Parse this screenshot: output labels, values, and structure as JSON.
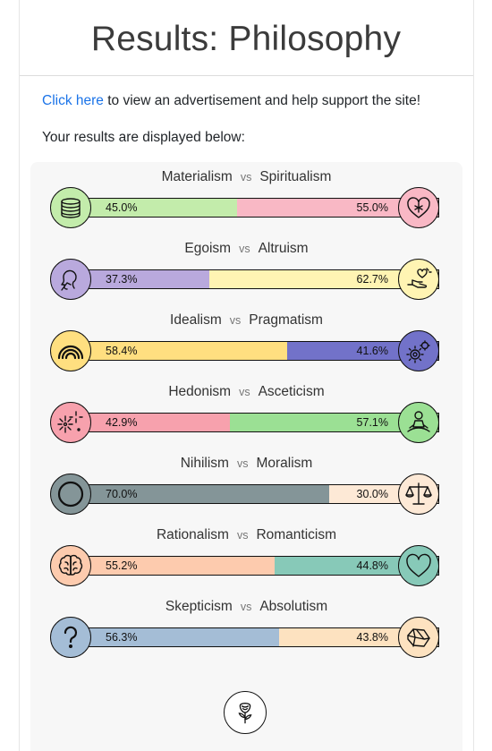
{
  "page": {
    "title": "Results: Philosophy",
    "ad_link": "Click here",
    "ad_rest": " to view an advertisement and help support the site!",
    "intro": "Your results are displayed below:",
    "vs": "vs"
  },
  "results": [
    {
      "left": "Materialism",
      "right": "Spiritualism",
      "left_pct": 45.0,
      "right_pct": 55.0,
      "left_label": "45.0%",
      "right_label": "55.0%",
      "left_color": "#c3ecab",
      "right_color": "#f9b8c5",
      "left_icon": "coins-icon",
      "right_icon": "heart-flower-icon"
    },
    {
      "left": "Egoism",
      "right": "Altruism",
      "left_pct": 37.3,
      "right_pct": 62.7,
      "left_label": "37.3%",
      "right_label": "62.7%",
      "left_color": "#b9a9dd",
      "right_color": "#fff4b3",
      "left_icon": "thinker-head-icon",
      "right_icon": "giving-hand-icon"
    },
    {
      "left": "Idealism",
      "right": "Pragmatism",
      "left_pct": 58.4,
      "right_pct": 41.6,
      "left_label": "58.4%",
      "right_label": "41.6%",
      "left_color": "#ffdf80",
      "right_color": "#7272c9",
      "left_icon": "rainbow-icon",
      "right_icon": "gears-icon"
    },
    {
      "left": "Hedonism",
      "right": "Asceticism",
      "left_pct": 42.9,
      "right_pct": 57.1,
      "left_label": "42.9%",
      "right_label": "57.1%",
      "left_color": "#f7a1ad",
      "right_color": "#9be094",
      "left_icon": "fireworks-icon",
      "right_icon": "meditation-icon"
    },
    {
      "left": "Nihilism",
      "right": "Moralism",
      "left_pct": 70.0,
      "right_pct": 30.0,
      "left_label": "70.0%",
      "right_label": "30.0%",
      "left_color": "#849598",
      "right_color": "#fde9d6",
      "left_icon": "empty-circle-icon",
      "right_icon": "scales-icon"
    },
    {
      "left": "Rationalism",
      "right": "Romanticism",
      "left_pct": 55.2,
      "right_pct": 44.8,
      "left_label": "55.2%",
      "right_label": "44.8%",
      "left_color": "#fdcbae",
      "right_color": "#87c9b8",
      "left_icon": "brain-icon",
      "right_icon": "heart-icon"
    },
    {
      "left": "Skepticism",
      "right": "Absolutism",
      "left_pct": 56.3,
      "right_pct": 43.8,
      "left_label": "56.3%",
      "right_label": "43.8%",
      "left_color": "#a4bdd6",
      "right_color": "#fde2c0",
      "left_icon": "question-mark-icon",
      "right_icon": "crystal-icon"
    }
  ],
  "footer": {
    "icon": "rose-icon"
  }
}
